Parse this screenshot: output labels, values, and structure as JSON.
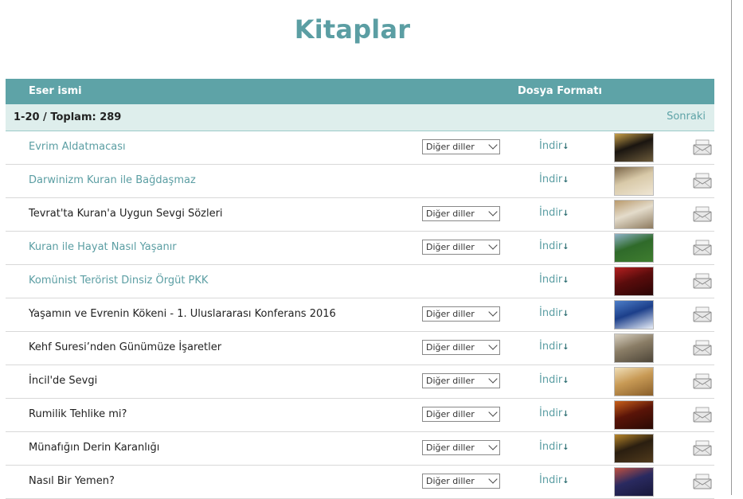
{
  "page_title": "Kitaplar",
  "table_header": {
    "name": "Eser ismi",
    "format": "Dosya Formatı"
  },
  "pager": {
    "count": "1-20 / Toplam: 289",
    "next": "Sonraki"
  },
  "download_label": "İndir",
  "language_select_value": "Diğer diller",
  "rows": [
    {
      "title": "Evrim Aldatmacası",
      "style": "link",
      "has_lang": true,
      "cover_colors": [
        "#1a1510",
        "#c8a04a",
        "#6b5a3a"
      ]
    },
    {
      "title": "Darwinizm Kuran ile Bağdaşmaz",
      "style": "link",
      "has_lang": false,
      "cover_colors": [
        "#d8c9a8",
        "#7a6548",
        "#efe6d4"
      ]
    },
    {
      "title": "Tevrat'ta Kuran'a Uygun Sevgi Sözleri",
      "style": "plain",
      "has_lang": true,
      "cover_colors": [
        "#e4dccb",
        "#b99a6c",
        "#8d7a5e"
      ]
    },
    {
      "title": "Kuran ile Hayat Nasıl Yaşanır",
      "style": "link",
      "has_lang": true,
      "cover_colors": [
        "#2f6a2a",
        "#8fb3c8",
        "#3f7d2f"
      ]
    },
    {
      "title": "Komünist Terörist Dinsiz Örgüt PKK",
      "style": "link",
      "has_lang": false,
      "cover_colors": [
        "#5a0c0c",
        "#b52020",
        "#2a0505"
      ]
    },
    {
      "title": "Yaşamın ve Evrenin Kökeni - 1. Uluslararası Konferans 2016",
      "style": "plain",
      "has_lang": true,
      "cover_colors": [
        "#1c3f8a",
        "#4d7ec8",
        "#e8eef8"
      ]
    },
    {
      "title": "Kehf Suresi’nden Günümüze İşaretler",
      "style": "plain",
      "has_lang": true,
      "cover_colors": [
        "#8a7d66",
        "#d8d0c0",
        "#4d4538"
      ]
    },
    {
      "title": "İncil'de Sevgi",
      "style": "plain",
      "has_lang": true,
      "cover_colors": [
        "#c89a55",
        "#f0dfb8",
        "#8a5f2a"
      ]
    },
    {
      "title": "Rumilik Tehlike mi?",
      "style": "plain",
      "has_lang": true,
      "cover_colors": [
        "#5a1408",
        "#c8601a",
        "#2a0a04"
      ]
    },
    {
      "title": "Münafığın Derin Karanlığı",
      "style": "plain",
      "has_lang": true,
      "cover_colors": [
        "#2a1e10",
        "#b8862a",
        "#503a1c"
      ]
    },
    {
      "title": "Nasıl Bir Yemen?",
      "style": "plain",
      "has_lang": true,
      "cover_colors": [
        "#2a2a60",
        "#c05040",
        "#18183a"
      ]
    }
  ],
  "colors": {
    "accent": "#5b9ea3",
    "header_bg": "#5ea3a7",
    "pager_bg": "#deeeec"
  },
  "icons": {
    "download": "arrow-down-icon",
    "mail": "envelope-icon",
    "select": "chevron-down-icon"
  }
}
